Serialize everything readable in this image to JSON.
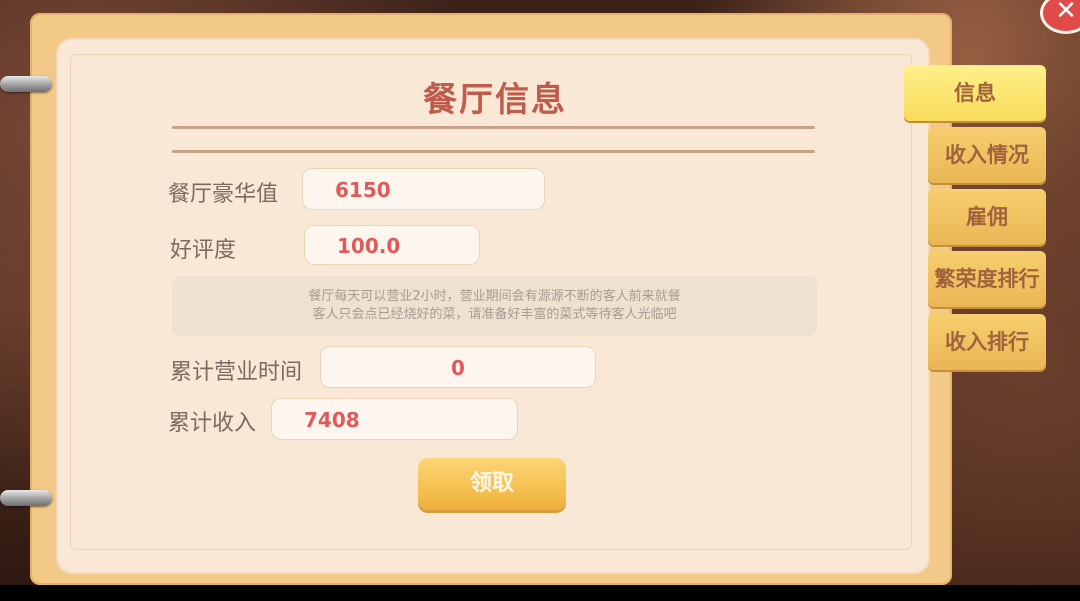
{
  "title": "餐厅信息",
  "fields": {
    "luxury": {
      "label": "餐厅豪华值",
      "value": "6150"
    },
    "rating": {
      "label": "好评度",
      "value": "100.0"
    },
    "hours": {
      "label": "累计营业时间",
      "value": "0"
    },
    "income": {
      "label": "累计收入",
      "value": "7408"
    }
  },
  "notice": {
    "line1": "餐厅每天可以营业2小时，营业期间会有源源不断的客人前来就餐",
    "line2": "客人只会点已经烧好的菜，请准备好丰富的菜式等待客人光临吧"
  },
  "claim_button": "领取",
  "tabs": [
    {
      "label": "信息",
      "active": true
    },
    {
      "label": "收入情况",
      "active": false
    },
    {
      "label": "雇佣",
      "active": false
    },
    {
      "label": "繁荣度排行",
      "active": false
    },
    {
      "label": "收入排行",
      "active": false
    }
  ],
  "close_icon": "close-icon",
  "colors": {
    "accent": "#c05c4c",
    "value": "#e05a5a",
    "tab": "#f2c36a"
  }
}
